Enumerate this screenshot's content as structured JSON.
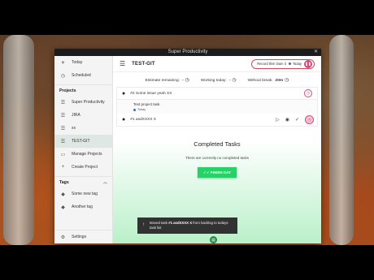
{
  "window": {
    "title": "Super Productivity",
    "close_glyph": "✕"
  },
  "sidebar": {
    "top_items": [
      {
        "label": "Today",
        "icon": "sun-icon",
        "glyph": "☀"
      },
      {
        "label": "Scheduled",
        "icon": "clock-icon",
        "glyph": "◷"
      }
    ],
    "projects_header": "Projects",
    "projects": [
      {
        "label": "Super Productivity",
        "icon": "list-icon",
        "glyph": "☰"
      },
      {
        "label": "JIRA",
        "icon": "list-icon",
        "glyph": "☰"
      },
      {
        "label": "xx",
        "icon": "list-icon",
        "glyph": "☰"
      },
      {
        "label": "TEST-GIT",
        "icon": "list-icon",
        "glyph": "☰",
        "active": true
      },
      {
        "label": "Manage Projects",
        "icon": "folder-icon",
        "glyph": "▭"
      },
      {
        "label": "Create Project",
        "icon": "plus-icon",
        "glyph": "+"
      }
    ],
    "tags_header": "Tags",
    "tags": [
      {
        "label": "Some new tag",
        "icon": "tag-icon",
        "glyph": "◆"
      },
      {
        "label": "Another tag",
        "icon": "tag-icon",
        "glyph": "◆"
      }
    ],
    "settings_label": "Settings",
    "settings_glyph": "⚙"
  },
  "header": {
    "menu_glyph": "☰",
    "title": "TEST-GIT",
    "record_text": "Record this! Dam it",
    "record_badge": "Today",
    "play_glyph": "❚❚"
  },
  "stats": {
    "estimate_label": "Estimate remaining:",
    "estimate_value": "-",
    "working_label": "Working today:",
    "working_value": "-",
    "without_break_label": "Without break:",
    "without_break_value": "20m",
    "clock_glyph": "◷"
  },
  "tasks": [
    {
      "title": "#2 Some issue yeah XX",
      "sub_title": "Test project task",
      "sub_tag": "Today"
    },
    {
      "title": "#1 asdXXXX X"
    }
  ],
  "completed": {
    "title": "Completed Tasks",
    "subtitle": "There are currently no completed tasks",
    "finish_label": "FINISH DAY",
    "finish_glyph": "✓✓"
  },
  "snackbar": {
    "prefix": "Moved task",
    "task": "#1 asdXXXX X",
    "suffix": "from backlog to todays task list"
  },
  "colors": {
    "accent": "#d04a7e",
    "success": "#26d265",
    "active_bg": "#dfe7e4"
  }
}
